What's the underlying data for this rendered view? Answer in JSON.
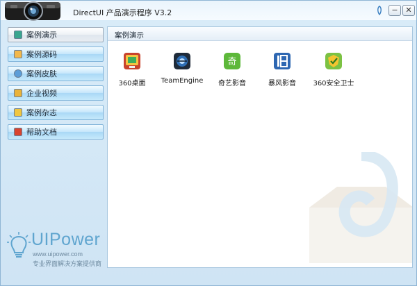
{
  "window": {
    "title": "DirectUI 产品演示程序 V3.2",
    "controls": {
      "minimize": "−",
      "close": "✕"
    }
  },
  "sidebar": {
    "items": [
      {
        "label": "案例演示",
        "icon": "monitor-icon",
        "active": true
      },
      {
        "label": "案例源码",
        "icon": "code-icon",
        "active": false
      },
      {
        "label": "案例皮肤",
        "icon": "skin-icon",
        "active": false
      },
      {
        "label": "企业视频",
        "icon": "video-icon",
        "active": false
      },
      {
        "label": "案例杂志",
        "icon": "magazine-icon",
        "active": false
      },
      {
        "label": "帮助文档",
        "icon": "help-icon",
        "active": false
      }
    ]
  },
  "brand": {
    "name": "UIPower",
    "url": "www.uipower.com",
    "tagline": "专业界面解决方案提供商"
  },
  "content": {
    "title": "案例演示",
    "apps": [
      {
        "label": "360桌面",
        "icon": "desktop-360-icon"
      },
      {
        "label": "TeamEngine",
        "icon": "team-engine-icon"
      },
      {
        "label": "奇艺影音",
        "icon": "qiyi-icon"
      },
      {
        "label": "暴风影音",
        "icon": "baofeng-icon"
      },
      {
        "label": "360安全卫士",
        "icon": "security-360-icon"
      }
    ]
  },
  "colors": {
    "accent": "#5fa5cf",
    "sidebar_button": "#c5e6fb",
    "panel_border": "#a8c7df"
  }
}
